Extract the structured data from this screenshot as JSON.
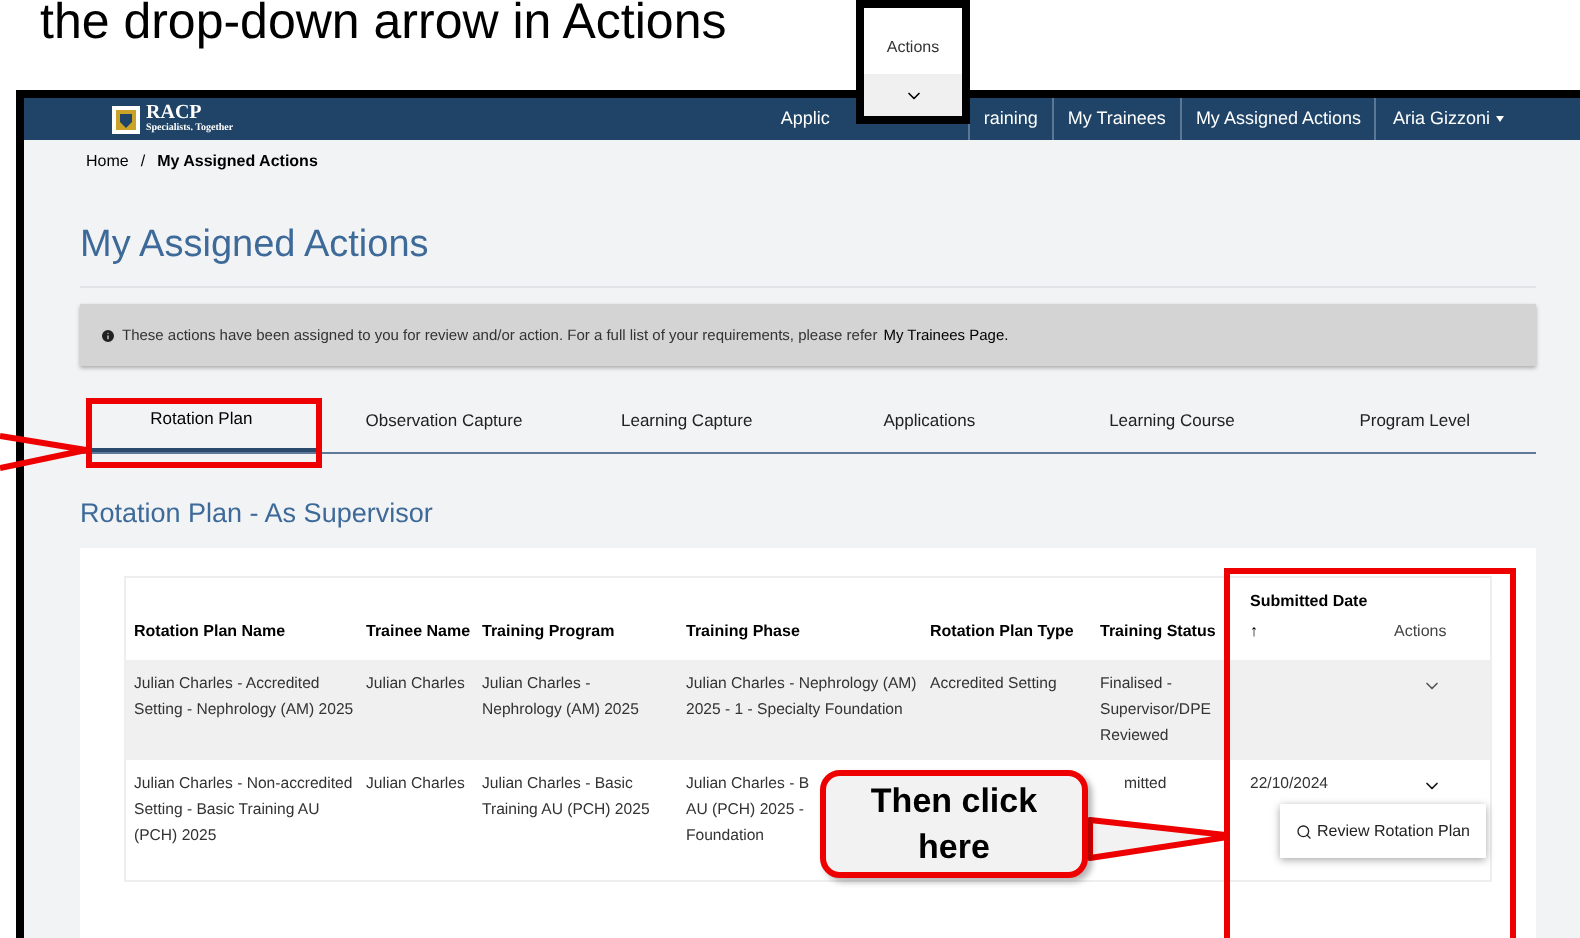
{
  "instruction": "the drop-down arrow in Actions",
  "inset": {
    "header": "Actions"
  },
  "logo": {
    "name": "RACP",
    "tagline": "Specialists. Together"
  },
  "nav": {
    "items": [
      "Applic",
      "raining",
      "My Trainees",
      "My Assigned Actions"
    ],
    "user": "Aria Gizzoni"
  },
  "breadcrumb": {
    "home": "Home",
    "separator": "/",
    "current": "My Assigned Actions"
  },
  "title": "My Assigned Actions",
  "info": {
    "text": "These actions have been assigned to you for review and/or action. For a full list of your requirements, please refer",
    "link": "My Trainees Page."
  },
  "tabs": [
    {
      "label": "Rotation Plan",
      "selected": true
    },
    {
      "label": "Observation Capture",
      "selected": false
    },
    {
      "label": "Learning Capture",
      "selected": false
    },
    {
      "label": "Applications",
      "selected": false
    },
    {
      "label": "Learning Course",
      "selected": false
    },
    {
      "label": "Program Level",
      "selected": false
    }
  ],
  "section_title": "Rotation Plan - As Supervisor",
  "table": {
    "columns": [
      "Rotation Plan Name",
      "Trainee Name",
      "Training Program",
      "Training Phase",
      "Rotation Plan Type",
      "Training Status",
      "Submitted Date",
      "Actions"
    ],
    "sort_indicator": "↑",
    "rows": [
      {
        "cells": [
          "Julian Charles - Accredited Setting - Nephrology (AM) 2025",
          "Julian Charles",
          "Julian Charles - Nephrology (AM) 2025",
          "Julian Charles - Nephrology (AM) 2025 - 1 - Specialty Foundation",
          "Accredited Setting",
          "Finalised - Supervisor/DPE Reviewed",
          ""
        ],
        "expanded": false
      },
      {
        "cells": [
          "Julian Charles - Non-accredited Setting - Basic Training AU (PCH) 2025",
          "Julian Charles",
          "Julian Charles - Basic Training AU (PCH) 2025",
          "Julian Charles - B\nAU (PCH) 2025 -\nFoundation",
          "",
          "mitted",
          "22/10/2024"
        ],
        "expanded": true,
        "menu_item": "Review Rotation Plan"
      }
    ]
  },
  "callout": "Then click here"
}
